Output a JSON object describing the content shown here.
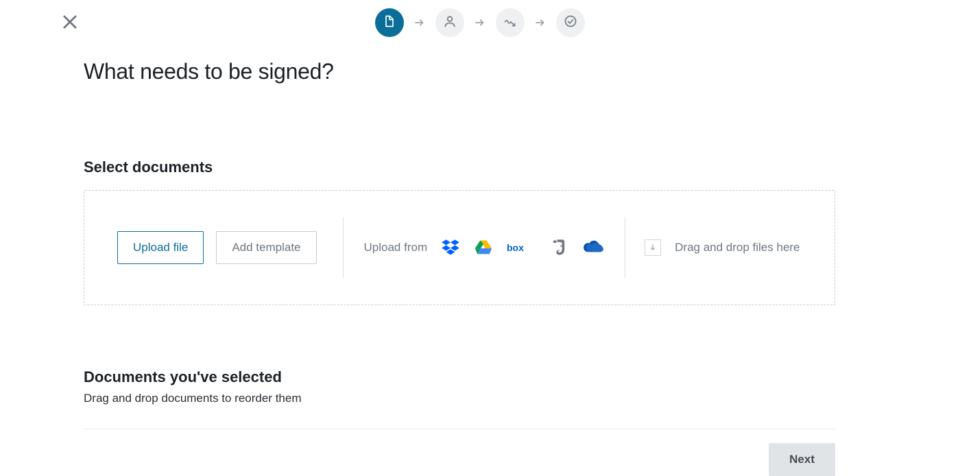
{
  "stepper": {
    "steps": [
      {
        "name": "document",
        "active": true
      },
      {
        "name": "recipients",
        "active": false
      },
      {
        "name": "place-fields",
        "active": false
      },
      {
        "name": "review",
        "active": false
      }
    ]
  },
  "page": {
    "title": "What needs to be signed?"
  },
  "select": {
    "label": "Select documents",
    "upload_button": "Upload file",
    "template_button": "Add template",
    "upload_from_label": "Upload from",
    "providers": [
      "dropbox",
      "google-drive",
      "box",
      "evernote",
      "onedrive"
    ],
    "drag_label": "Drag and drop files here"
  },
  "selected": {
    "title": "Documents you've selected",
    "subtitle": "Drag and drop documents to reorder them"
  },
  "footer": {
    "next": "Next"
  }
}
